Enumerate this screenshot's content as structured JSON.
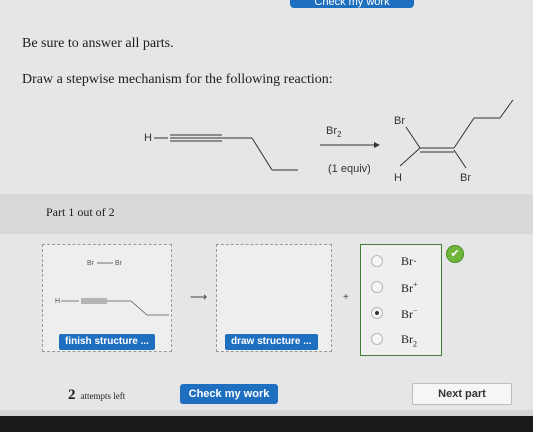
{
  "header": {
    "top_button_label": "Check my work"
  },
  "instructions": {
    "line1": "Be sure to answer all parts.",
    "line2": "Draw a stepwise mechanism for the following reaction:"
  },
  "reaction": {
    "reactant_h": "H",
    "reagent": "Br",
    "reagent_sub": "2",
    "equiv": "(1 equiv)",
    "product_br_top": "Br",
    "product_h": "H",
    "product_br_bottom": "Br"
  },
  "part": {
    "label": "Part 1 out of 2"
  },
  "left_box": {
    "br_left": "Br",
    "br_right": "Br",
    "h_label": "H",
    "button_label": "finish structure ..."
  },
  "middle_box": {
    "button_label": "draw structure ..."
  },
  "arrow_glyph": "⟶",
  "plus_glyph": "+",
  "choices": [
    {
      "text": "Br·",
      "selected": false
    },
    {
      "text": "Br",
      "sup": "+",
      "selected": false
    },
    {
      "text": "Br",
      "sup": "−",
      "selected": true
    },
    {
      "text": "Br",
      "sub": "2",
      "selected": false
    }
  ],
  "check_badge": "✔",
  "footer": {
    "attempts_count": "2",
    "attempts_text": "attempts left",
    "check_label": "Check my work",
    "next_label": "Next part"
  }
}
